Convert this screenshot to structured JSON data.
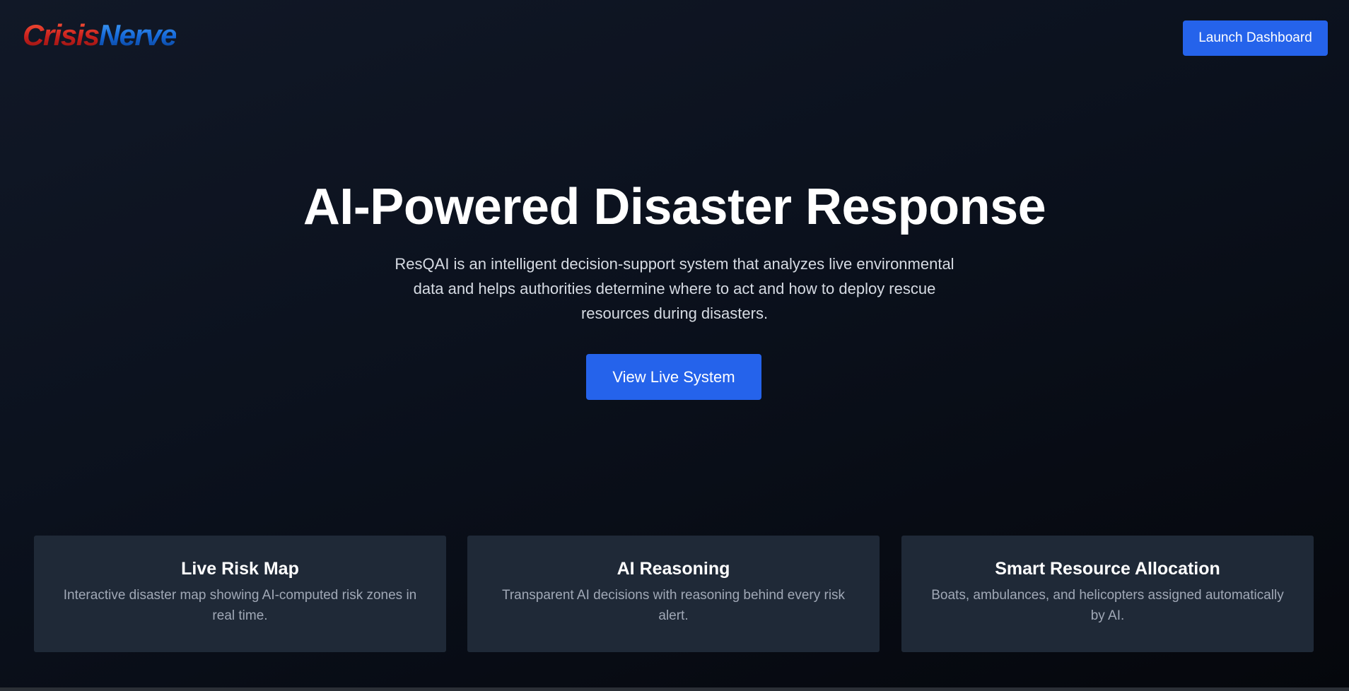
{
  "header": {
    "logo_part1": "Crisis",
    "logo_part2": "Nerve",
    "launch_button": "Launch Dashboard"
  },
  "hero": {
    "title": "AI-Powered Disaster Response",
    "description": "ResQAI is an intelligent decision-support system that analyzes live environmental data and helps authorities determine where to act and how to deploy rescue resources during disasters.",
    "cta_button": "View Live System"
  },
  "features": [
    {
      "title": "Live Risk Map",
      "text": "Interactive disaster map showing AI-computed risk zones in real time."
    },
    {
      "title": "AI Reasoning",
      "text": "Transparent AI decisions with reasoning behind every risk alert."
    },
    {
      "title": "Smart Resource Allocation",
      "text": "Boats, ambulances, and helicopters assigned automatically by AI."
    }
  ],
  "colors": {
    "accent": "#2563eb",
    "card_background": "#1f2937",
    "page_background": "#0b111d",
    "logo_red": "#d42a1f",
    "logo_blue": "#1466d6"
  }
}
